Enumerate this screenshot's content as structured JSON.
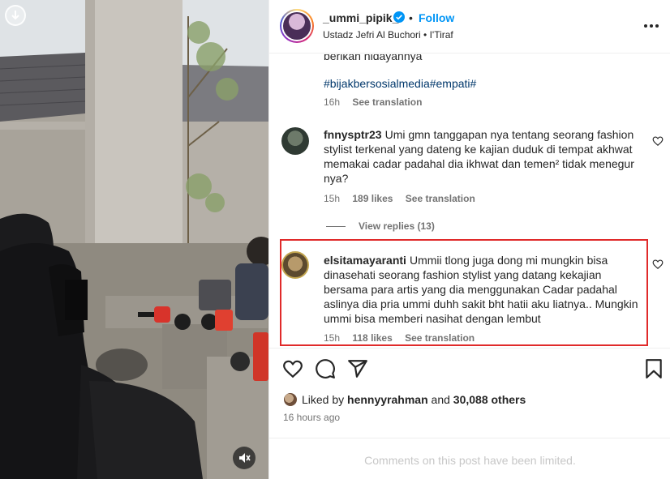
{
  "header": {
    "username": "_ummi_pipik_",
    "separator": "•",
    "follow_label": "Follow",
    "subtitle": "Ustadz Jefri Al Buchori • I'Tiraf"
  },
  "caption": {
    "cut_text": "berikan hidayahnya",
    "hashtags": "#bijakbersosialmedia#empati#",
    "time": "16h",
    "see_translation": "See translation"
  },
  "comments": [
    {
      "username": "fnnysptr23",
      "text": "Umi gmn tanggapan nya tentang seorang fashion stylist terkenal yang dateng ke kajian duduk di tempat akhwat memakai cadar padahal dia ikhwat dan temen² tidak menegur nya?",
      "time": "15h",
      "likes": "189 likes",
      "see_translation": "See translation",
      "view_replies": "View replies (13)"
    },
    {
      "username": "elsitamayaranti",
      "text": "Ummii tlong juga dong mi mungkin bisa dinasehati seorang fashion stylist yang datang kekajian bersama para artis yang dia menggunakan Cadar padahal aslinya dia pria ummi duhh sakit bht hatii aku liatnya.. Mungkin ummi bisa memberi nasihat dengan lembut",
      "time": "15h",
      "likes": "118 likes",
      "see_translation": "See translation"
    }
  ],
  "likes": {
    "prefix": "Liked by",
    "user": "hennyyrahman",
    "mid": "and",
    "count": "30,088 others"
  },
  "time_ago": "16 hours ago",
  "limited_notice": "Comments on this post have been limited.",
  "colors": {
    "accent": "#0095f6",
    "highlight_border": "#e02a2a",
    "muted_text": "#737373"
  }
}
